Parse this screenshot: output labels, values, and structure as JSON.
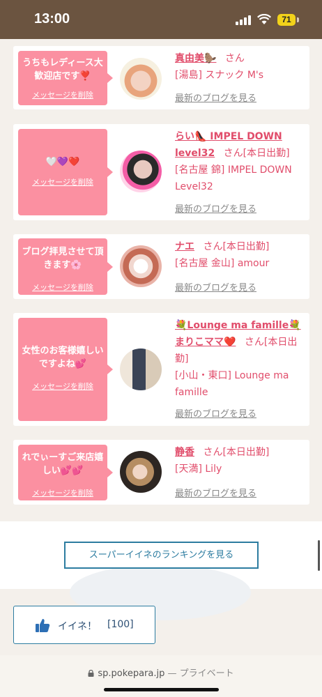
{
  "status_bar": {
    "time": "13:00",
    "battery": "71"
  },
  "cards": [
    {
      "message": "うちもレディース大歓迎店です❣️",
      "delete": "メッセージを削除",
      "name": "真由美🦫",
      "honorific": "さん",
      "extra": "",
      "shop": "[湯島] スナック M's",
      "blog": "最新のブログを見る"
    },
    {
      "message": "🤍💜❤️",
      "delete": "メッセージを削除",
      "name": "らい👠 IMPEL DOWN level32",
      "honorific": "さん",
      "extra": "[本日出勤]",
      "shop": "[名古屋 錦] IMPEL DOWN Level32",
      "blog": "最新のブログを見る"
    },
    {
      "message": "ブログ拝見させて頂きます🌸",
      "delete": "メッセージを削除",
      "name": "ナエ",
      "honorific": "さん",
      "extra": "[本日出勤]",
      "shop": "[名古屋 金山] amour",
      "blog": "最新のブログを見る"
    },
    {
      "message": "女性のお客様嬉しいですよね💕",
      "delete": "メッセージを削除",
      "name": "💐Lounge ma famille💐まりこママ❤️",
      "honorific": "さん",
      "extra": "[本日出勤]",
      "shop": "[小山・東口] Lounge ma famille",
      "blog": "最新のブログを見る"
    },
    {
      "message": "れでぃーすご来店嬉しい💕💕",
      "delete": "メッセージを削除",
      "name": "静香",
      "honorific": "さん",
      "extra": "[本日出勤]",
      "shop": "[天満] Lily",
      "blog": "最新のブログを見る"
    }
  ],
  "ranking_button": "スーパーイイネのランキングを見る",
  "like_button": {
    "label": "イイネ！",
    "count": "[100]"
  },
  "url_bar": {
    "domain": "sp.pokepara.jp",
    "suffix": " — プライベート"
  },
  "colors": {
    "accent_pink": "#fb90a1",
    "name_pink": "#e14d6b",
    "button_blue": "#2c7ca0",
    "status_bar_brown": "#6b5440"
  }
}
